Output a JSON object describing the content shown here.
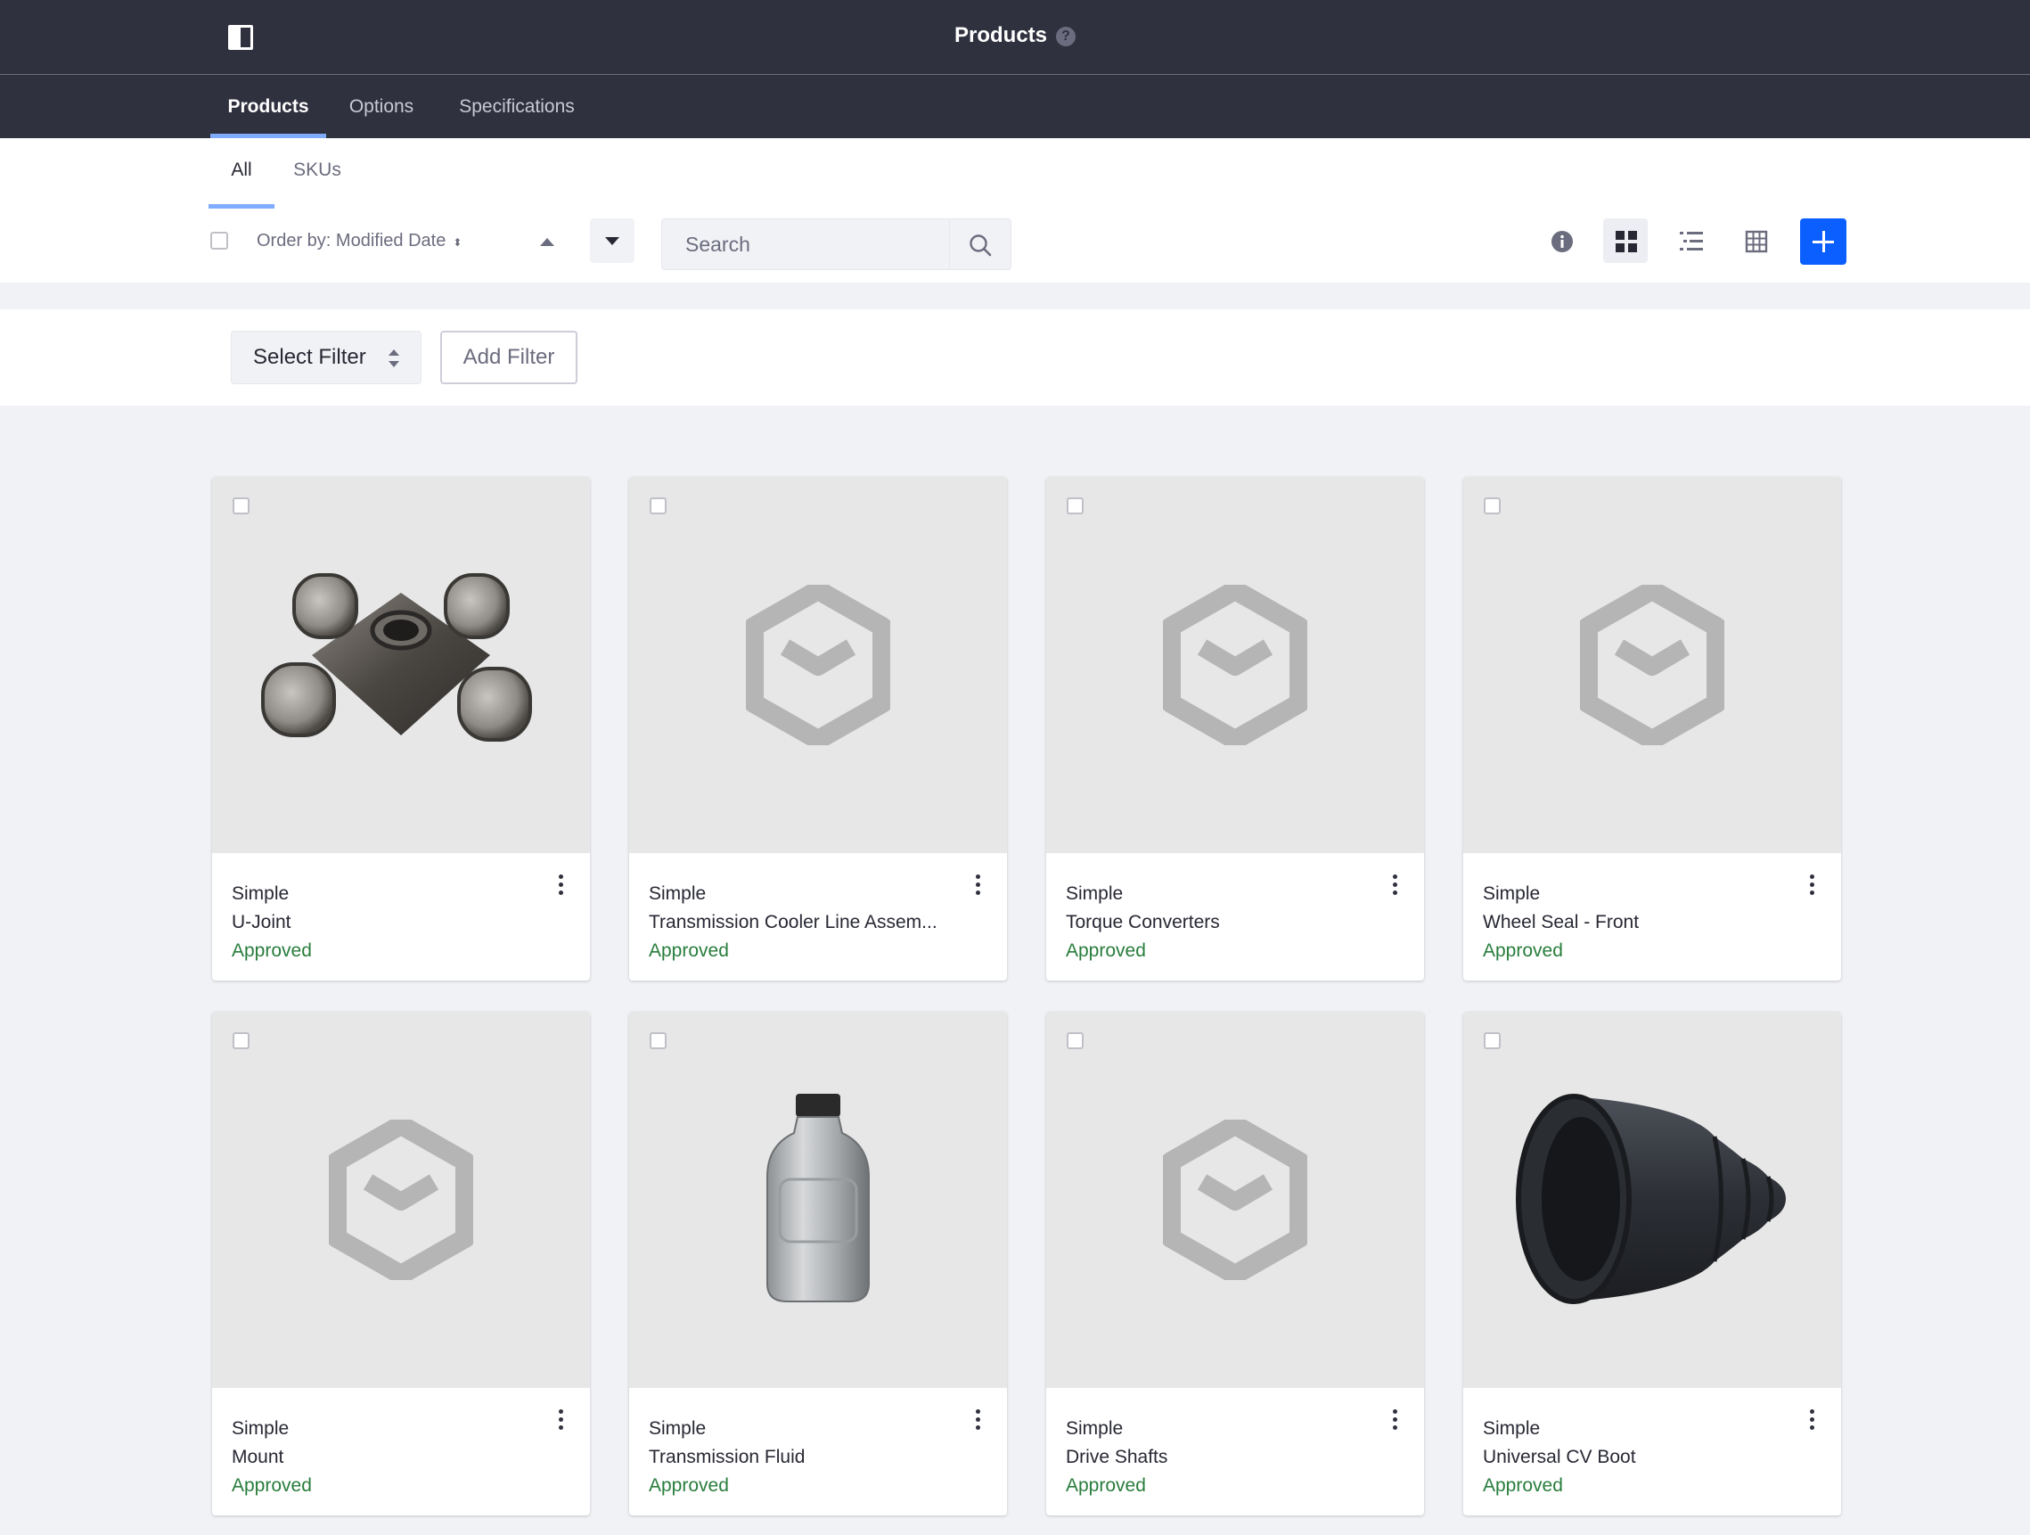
{
  "header": {
    "title": "Products",
    "help_icon": "?"
  },
  "nav": {
    "tabs": [
      {
        "label": "Products",
        "active": true
      },
      {
        "label": "Options",
        "active": false
      },
      {
        "label": "Specifications",
        "active": false
      }
    ]
  },
  "subnav": {
    "tabs": [
      {
        "label": "All",
        "active": true
      },
      {
        "label": "SKUs",
        "active": false
      }
    ]
  },
  "toolbar": {
    "order_by": "Order by: Modified Date",
    "search_placeholder": "Search",
    "icons": [
      "info-icon",
      "cards-view-icon",
      "list-view-icon",
      "table-view-icon",
      "add-icon"
    ],
    "accent": "#0b5fff"
  },
  "filters": {
    "select_label": "Select Filter",
    "add_label": "Add Filter"
  },
  "cards": [
    {
      "type": "Simple",
      "name": "U-Joint",
      "status": "Approved",
      "image": "u-joint"
    },
    {
      "type": "Simple",
      "name": "Transmission Cooler Line Assem...",
      "status": "Approved",
      "image": "placeholder"
    },
    {
      "type": "Simple",
      "name": "Torque Converters",
      "status": "Approved",
      "image": "placeholder"
    },
    {
      "type": "Simple",
      "name": "Wheel Seal - Front",
      "status": "Approved",
      "image": "placeholder"
    },
    {
      "type": "Simple",
      "name": "Mount",
      "status": "Approved",
      "image": "placeholder"
    },
    {
      "type": "Simple",
      "name": "Transmission Fluid",
      "status": "Approved",
      "image": "fluid-bottle"
    },
    {
      "type": "Simple",
      "name": "Drive Shafts",
      "status": "Approved",
      "image": "placeholder"
    },
    {
      "type": "Simple",
      "name": "Universal CV Boot",
      "status": "Approved",
      "image": "cv-boot"
    }
  ],
  "colors": {
    "header_bg": "#30313f",
    "status_approved": "#287d3c",
    "tab_underline": "#80acff"
  }
}
